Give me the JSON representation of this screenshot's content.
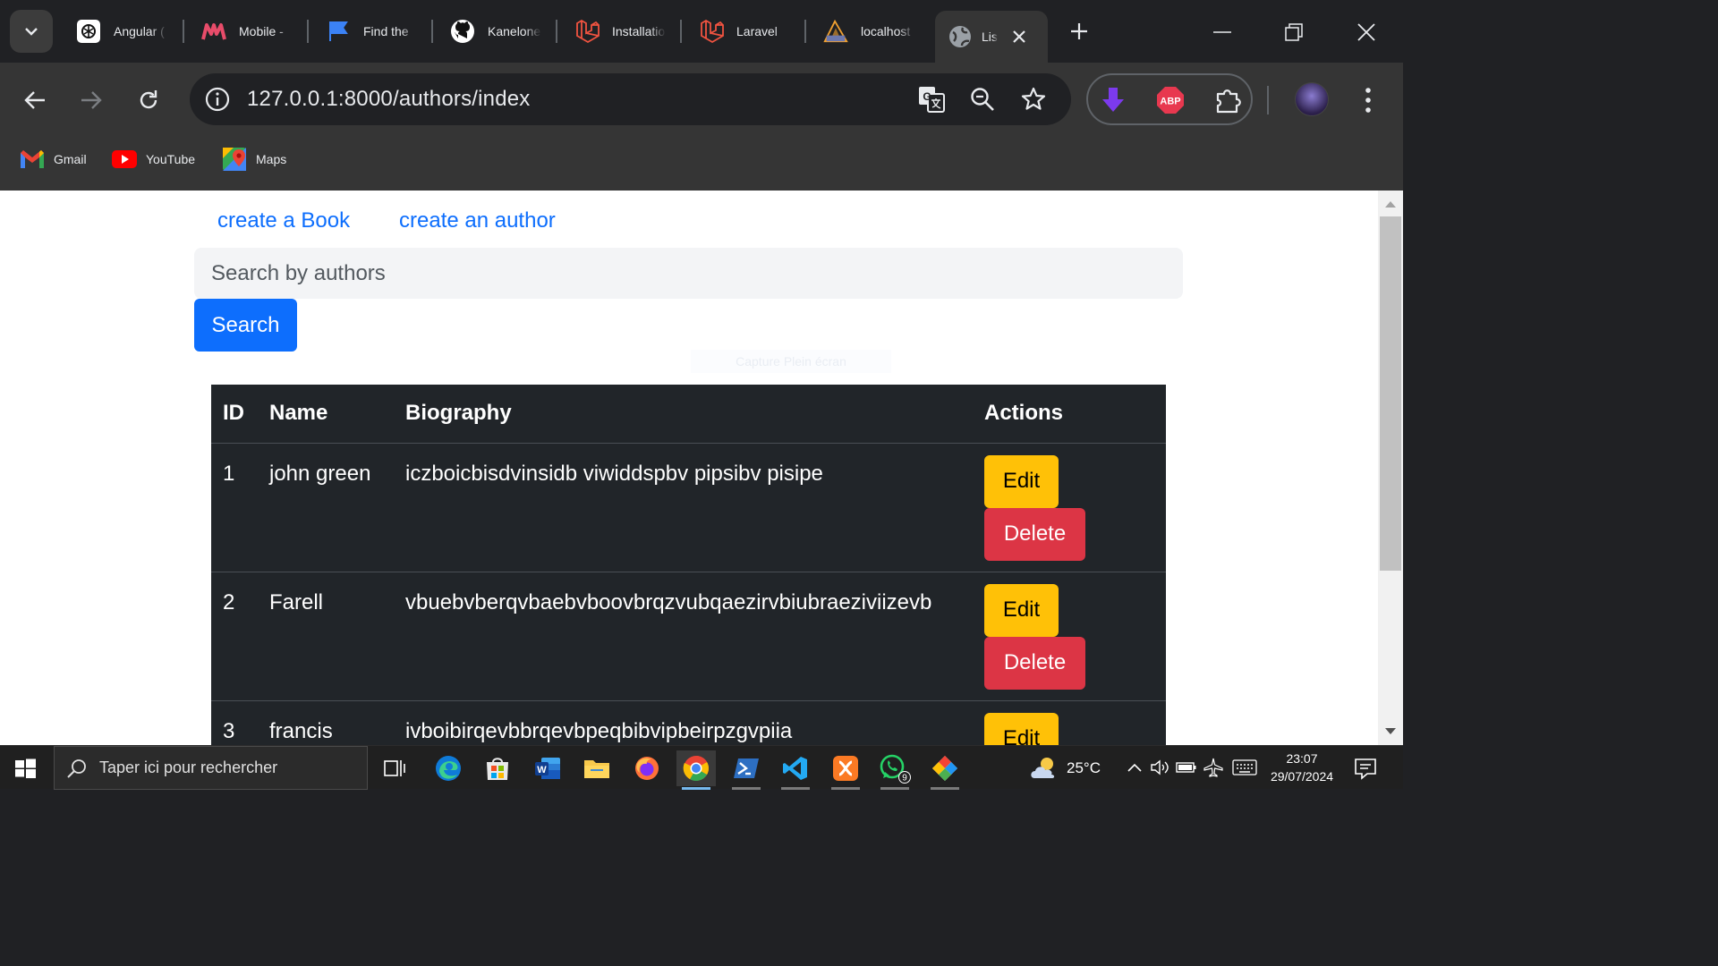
{
  "browser": {
    "tabs": [
      {
        "title": "Angular (",
        "icon": "chatgpt-icon"
      },
      {
        "title": "Mobile -",
        "icon": "brand-m-icon"
      },
      {
        "title": "Find the ",
        "icon": "flag-icon"
      },
      {
        "title": "Kanelone",
        "icon": "github-icon"
      },
      {
        "title": "Installatio",
        "icon": "laravel-icon"
      },
      {
        "title": "Laravel",
        "icon": "laravel-icon"
      },
      {
        "title": "localhost",
        "icon": "phpmyadmin-icon"
      },
      {
        "title": "Lis",
        "icon": "globe-icon",
        "active": true
      }
    ],
    "url": "127.0.0.1:8000/authors/index",
    "extensions": [
      "download-arrow-icon",
      "abp-icon",
      "puzzle-icon"
    ],
    "abp_label": "ABP",
    "bookmarks": [
      {
        "label": "Gmail",
        "icon": "gmail-icon"
      },
      {
        "label": "YouTube",
        "icon": "youtube-icon"
      },
      {
        "label": "Maps",
        "icon": "maps-icon"
      }
    ]
  },
  "page": {
    "links": {
      "create_book": "create a Book",
      "create_author": "create an author"
    },
    "search": {
      "placeholder": "Search by authors",
      "button": "Search"
    },
    "watermark": "Capture Plein écran",
    "table": {
      "headers": {
        "id": "ID",
        "name": "Name",
        "biography": "Biography",
        "actions": "Actions"
      },
      "edit_label": "Edit",
      "delete_label": "Delete",
      "rows": [
        {
          "id": "1",
          "name": "john green",
          "biography": "iczboicbisdvinsidb viwiddspbv pipsibv pisipe"
        },
        {
          "id": "2",
          "name": "Farell",
          "biography": "vbuebvberqvbaebvboovbrqzvubqaezirvbiubraeziviizevb"
        },
        {
          "id": "3",
          "name": "francis",
          "biography": "ivboibirqevbbrqevbpeqbibvipbeirpzgvpiia"
        }
      ]
    }
  },
  "taskbar": {
    "search_placeholder": "Taper ici pour rechercher",
    "weather": "25°C",
    "time": "23:07",
    "date": "29/07/2024",
    "whatsapp_badge": "9"
  },
  "colors": {
    "primary": "#0d6efd",
    "warning": "#ffc107",
    "danger": "#dc3545",
    "table_dark": "#212529"
  }
}
